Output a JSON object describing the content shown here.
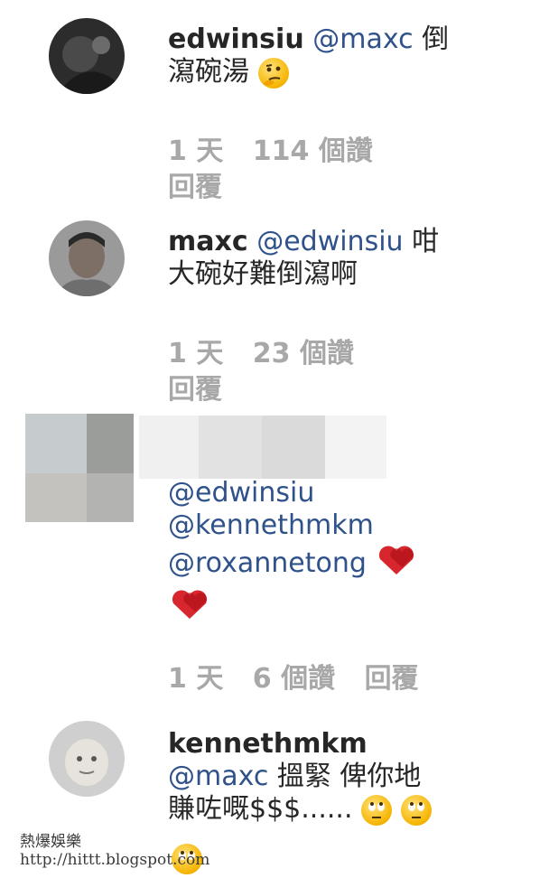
{
  "comments": [
    {
      "username": "edwinsiu",
      "mention": "@maxc",
      "text_line1_tail": "倒",
      "text_line2": "瀉碗湯",
      "emoji": "thinking-face-icon",
      "time": "1 天",
      "likes": "114 個讚",
      "reply": "回覆"
    },
    {
      "username": "maxc",
      "mention": "@edwinsiu",
      "text_line1_tail": "咁",
      "text_line2": "大碗好難倒瀉啊",
      "time": "1 天",
      "likes": "23 個讚",
      "reply": "回覆"
    },
    {
      "mentions": [
        "@edwinsiu",
        "@kennethmkm",
        "@roxannetong"
      ],
      "emoji": "red-hearts-icon",
      "time": "1 天",
      "likes": "6 個讚",
      "reply": "回覆"
    },
    {
      "username": "kennethmkm",
      "mention": "@maxc",
      "text_line1_tail": "搵緊 俾你地",
      "text_line2": "賺咗嘅$$$......",
      "emoji": "eye-roll-face-icon"
    }
  ],
  "watermark": {
    "line1": "熱爆娛樂",
    "line2": "http://hittt.blogspot.com"
  }
}
